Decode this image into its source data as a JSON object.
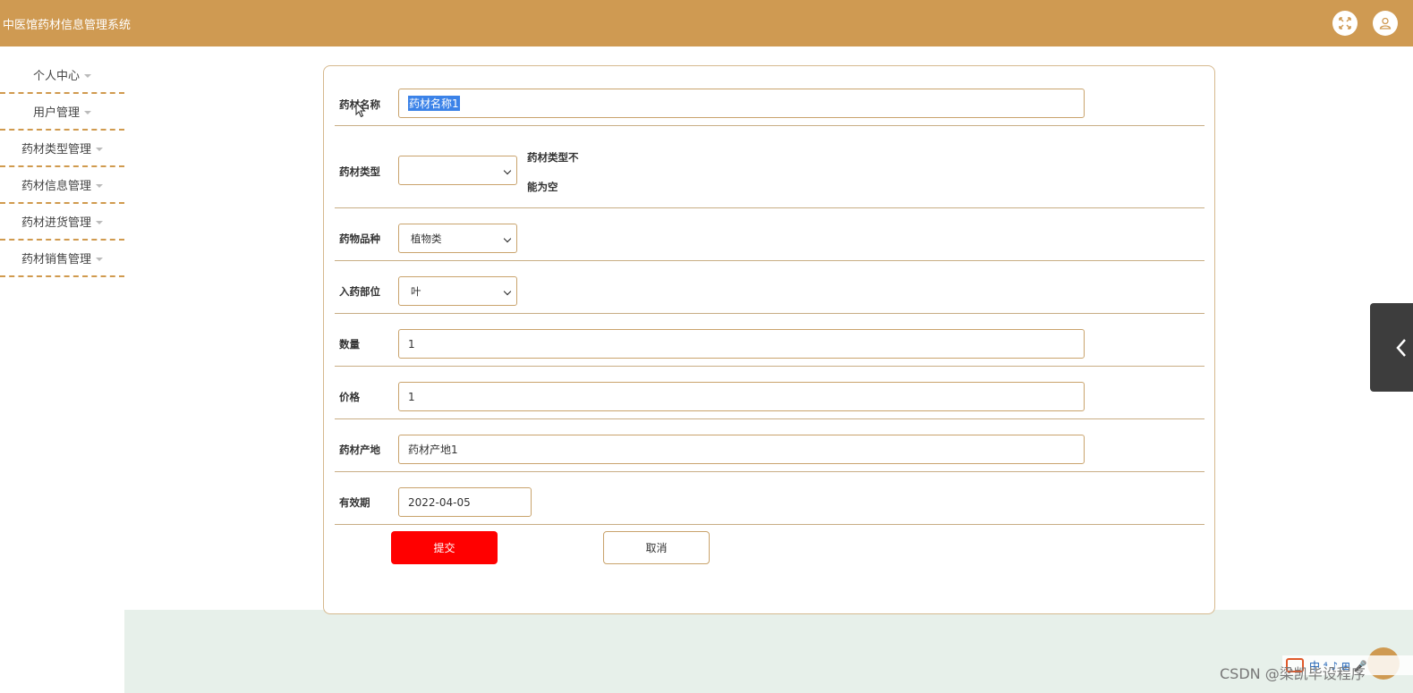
{
  "app": {
    "title": "中医馆药材信息管理系统"
  },
  "sidebar": {
    "items": [
      {
        "label": "个人中心"
      },
      {
        "label": "用户管理"
      },
      {
        "label": "药材类型管理"
      },
      {
        "label": "药材信息管理"
      },
      {
        "label": "药材进货管理"
      },
      {
        "label": "药材销售管理"
      }
    ]
  },
  "form": {
    "name": {
      "label": "药材名称",
      "value": "药材名称1"
    },
    "type": {
      "label": "药材类型",
      "value": "",
      "error_line1": "药材类型不",
      "error_line2": "能为空"
    },
    "variety": {
      "label": "药物品种",
      "value": "植物类"
    },
    "part": {
      "label": "入药部位",
      "value": "叶"
    },
    "quantity": {
      "label": "数量",
      "value": "1"
    },
    "price": {
      "label": "价格",
      "value": "1"
    },
    "origin": {
      "label": "药材产地",
      "value": "药材产地1"
    },
    "expiry": {
      "label": "有效期",
      "value": "2022-04-05"
    },
    "submit_label": "提交",
    "cancel_label": "取消"
  },
  "watermark": "CSDN @梁凯毕设程序",
  "ime": {
    "text": "中 ⁴ ♪ ⊞ 🎤"
  },
  "colors": {
    "header": "#cf9a52",
    "submit": "#ff0000",
    "footer": "#e7f0ea"
  },
  "icons": {
    "fullscreen": "expand-icon",
    "user": "user-icon",
    "toggle": "chevron-left-icon"
  }
}
